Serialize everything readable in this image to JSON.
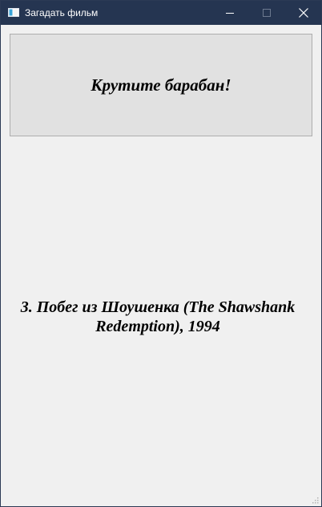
{
  "window": {
    "title": "Загадать фильм",
    "controls": {
      "minimize_icon": "minimize-icon",
      "maximize_icon": "maximize-icon",
      "close_icon": "close-icon"
    }
  },
  "main": {
    "spin_button_label": "Крутите барабан!",
    "result_text": "3. Побег из Шоушенка (The Shawshank Redemption), 1994"
  },
  "colors": {
    "titlebar": "#253551",
    "background": "#f0f0f0",
    "button_face": "#e1e1e1",
    "button_border": "#adadad"
  }
}
